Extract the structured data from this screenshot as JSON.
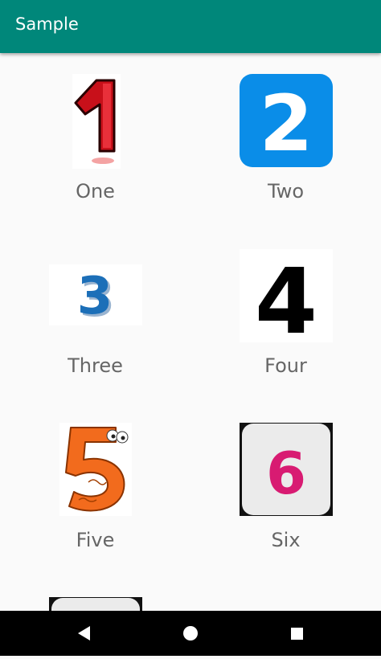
{
  "app_bar": {
    "title": "Sample"
  },
  "items": [
    {
      "label": "One",
      "image": "number-one-red-icon"
    },
    {
      "label": "Two",
      "image": "number-two-blue-tile-icon"
    },
    {
      "label": "Three",
      "image": "number-three-blue-icon"
    },
    {
      "label": "Four",
      "image": "number-four-black-icon"
    },
    {
      "label": "Five",
      "image": "number-five-cartoon-icon"
    },
    {
      "label": "Six",
      "image": "number-six-pink-tile-icon"
    },
    {
      "label": "",
      "image": "partial-seven-tile"
    }
  ],
  "nav_bar": {
    "buttons": [
      "back-icon",
      "home-icon",
      "recents-icon"
    ]
  },
  "colors": {
    "app_bar": "#00877a",
    "label_text": "#666666",
    "background": "#fafafa",
    "nav_bar": "#000000"
  }
}
